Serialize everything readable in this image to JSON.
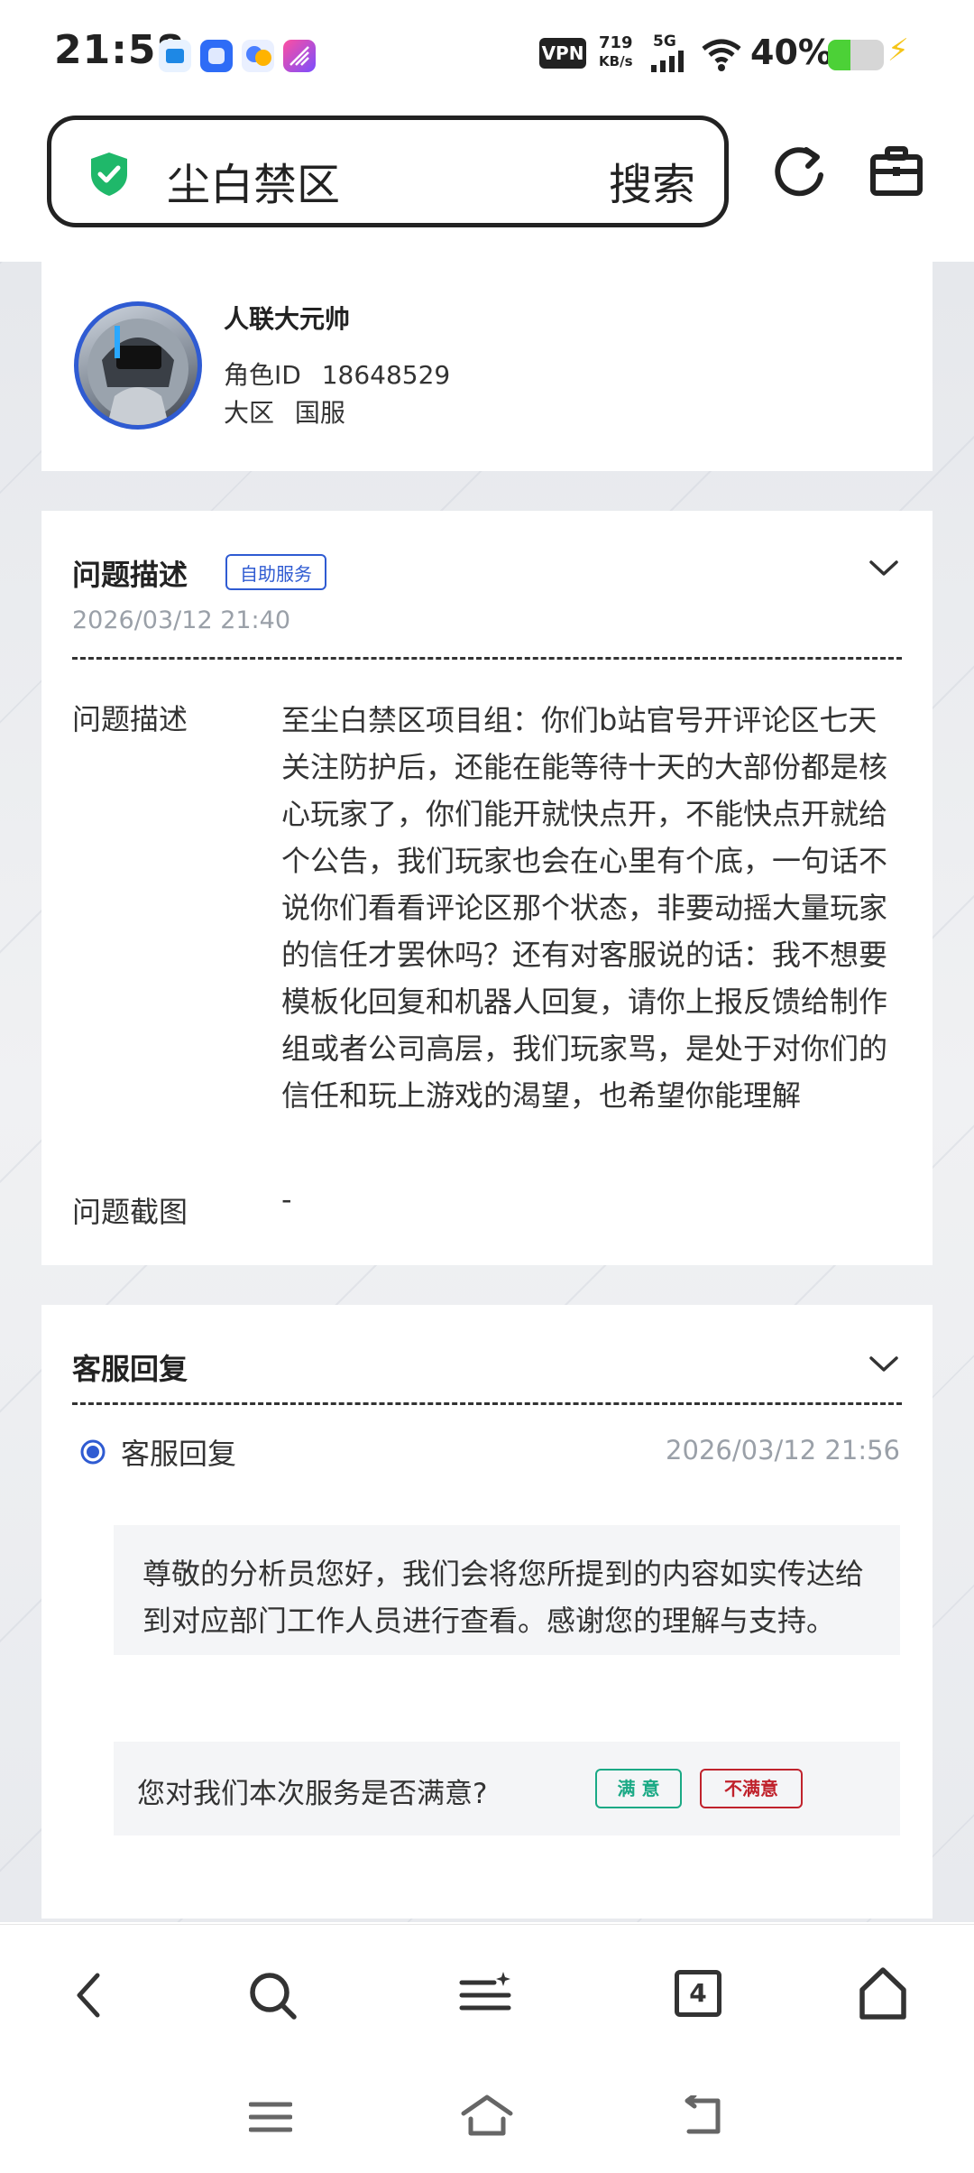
{
  "status_bar": {
    "time": "21:58",
    "vpn": "VPN",
    "speed_value": "719",
    "speed_unit": "KB/s",
    "network": "5G",
    "battery": "40%",
    "battery_level": 0.4,
    "app_icon_colors": [
      "#1e88e5",
      "#2e6cf6",
      "#4a7fff",
      "#9c4dff"
    ]
  },
  "search_bar": {
    "title": "尘白禁区",
    "search_label": "搜索"
  },
  "profile": {
    "name": "人联大元帅",
    "role_id_label": "角色ID",
    "role_id": "18648529",
    "region_label": "大区",
    "region": "国服"
  },
  "issue": {
    "title": "问题描述",
    "tag": "自助服务",
    "date": "2026/03/12 21:40",
    "desc_label": "问题描述",
    "desc_text": "至尘白禁区项目组：你们b站官号开评论区七天关注防护后，还能在能等待十天的大部份都是核心玩家了，你们能开就快点开，不能快点开就给个公告，我们玩家也会在心里有个底，一句话不说你们看看评论区那个状态，非要动摇大量玩家的信任才罢休吗？还有对客服说的话：我不想要模板化回复和机器人回复，请你上报反馈给制作组或者公司高层，我们玩家骂，是处于对你们的信任和玩上游戏的渴望，也希望你能理解",
    "screenshot_label": "问题截图",
    "screenshot_value": "-"
  },
  "reply": {
    "title": "客服回复",
    "item_label": "客服回复",
    "date": "2026/03/12 21:56",
    "text": "尊敬的分析员您好，我们会将您所提到的内容如实传达给到对应部门工作人员进行查看。感谢您的理解与支持。",
    "satisfaction_question": "您对我们本次服务是否满意?",
    "satisfied": "满 意",
    "unsatisfied": "不满意"
  },
  "bottom_nav": {
    "tab_count": "4"
  },
  "colors": {
    "accent_blue": "#2f5bd2",
    "shield_green": "#1fb86a",
    "satisfied_green": "#1aa985",
    "unsatisfied_red": "#c0222c"
  }
}
